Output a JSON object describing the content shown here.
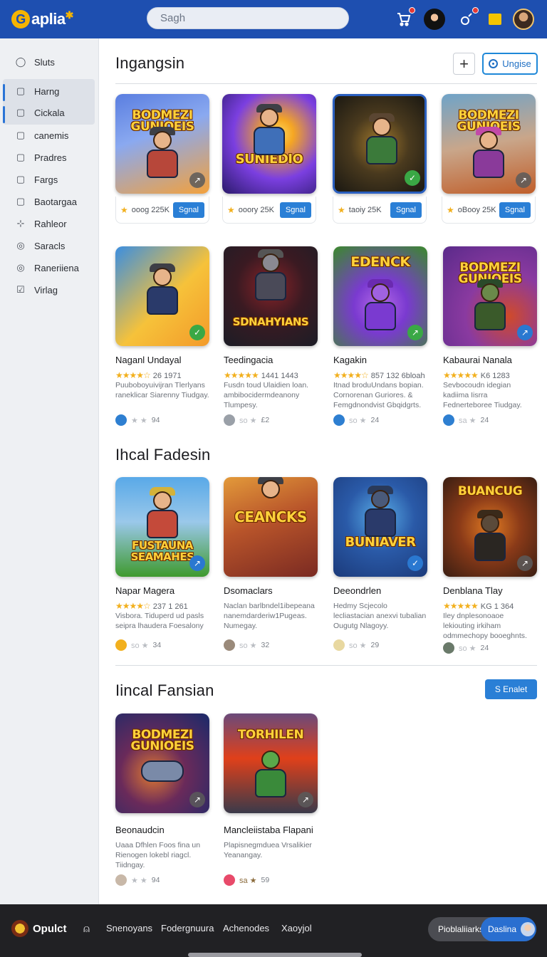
{
  "header": {
    "logo_text": "aplia",
    "search_placeholder": "Sagh",
    "icons": [
      "cart-icon",
      "user-avatar",
      "notification-icon",
      "yellow-square-icon",
      "profile-avatar"
    ]
  },
  "sidebar": {
    "items": [
      {
        "label": "Sluts",
        "icon": "chat-icon"
      },
      {
        "label": "Harng",
        "icon": "square-icon"
      },
      {
        "label": "Cickala",
        "icon": "square-icon"
      },
      {
        "label": "canemis",
        "icon": "square-icon"
      },
      {
        "label": "Pradres",
        "icon": "square-icon"
      },
      {
        "label": "Fargs",
        "icon": "square-icon"
      },
      {
        "label": "Baotargaa",
        "icon": "square-icon"
      },
      {
        "label": "Rahleor",
        "icon": "adjust-icon"
      },
      {
        "label": "Saracls",
        "icon": "target-icon"
      },
      {
        "label": "Raneriiena",
        "icon": "target-icon"
      },
      {
        "label": "Virlag",
        "icon": "check-square-icon"
      }
    ]
  },
  "sections": [
    {
      "title": "Ingangsin",
      "buttons": {
        "plus": "+",
        "outline": "Ungise"
      },
      "cards": [
        {
          "thumb_title": "BODMEZI GUNIOEIS",
          "price": "ooog 225K",
          "button": "Sgnal",
          "colors": [
            "#5a7ee0",
            "#f3a13c"
          ]
        },
        {
          "thumb_title": "SUNIEDIO",
          "price": "ooory 25K",
          "button": "Sgnal",
          "colors": [
            "#7b3fe0",
            "#f5a623"
          ]
        },
        {
          "thumb_title": "",
          "price": "taoiy 25K",
          "button": "Sgnal",
          "colors": [
            "#2f2a1e",
            "#a37a2c"
          ]
        },
        {
          "thumb_title": "BODMEZI GUNIOEIS",
          "price": "oBooy 25K",
          "button": "Sgnal",
          "colors": [
            "#6fa3c8",
            "#c05e2a"
          ]
        }
      ]
    },
    {
      "title": "",
      "cards": [
        {
          "thumb_title": "",
          "name": "Naganl Undayal",
          "rating": "26 1971",
          "desc": "Puuboboyuivijran Tlerlyans raneklicar Siarenny Tiudgay.",
          "meta": "94",
          "colors": [
            "#f6c23a",
            "#3b8ee0"
          ]
        },
        {
          "thumb_title": "SDNAHYIANS",
          "name": "Teedingacia",
          "rating": "1441 1443",
          "desc": "Fusdn toud Ulaidien loan. ambibocidermdeanony Tlumpesy.",
          "meta": "£2",
          "colors": [
            "#1c1d26",
            "#8a2328"
          ]
        },
        {
          "thumb_title": "EDENCK",
          "name": "Kagakin",
          "rating": "857 132 6bloah",
          "desc": "Itnad broduUndans bopian. Cornorenan Guriores. & Femgdnondvist Gbqidgrts.",
          "meta": "24",
          "colors": [
            "#3a8a2a",
            "#7a3ad0"
          ]
        },
        {
          "thumb_title": "BODMEZI GUNIOEIS",
          "name": "Kabaurai Nanala",
          "rating": "K6 1283",
          "desc": "Sevbocoudn idegian kadiima Iisrra Fednerteboree Tiudgay.",
          "meta": "24",
          "colors": [
            "#5a2a8a",
            "#d04a2a"
          ]
        }
      ]
    },
    {
      "title": "Ihcal Fadesin",
      "cards": [
        {
          "thumb_title": "FUSTAUNA SEAMAHES",
          "name": "Napar Magera",
          "rating": "237 1 261",
          "desc": "Visbora. Tiduperd ud pasls seipra lhaudera Foesalony",
          "meta": "34",
          "colors": [
            "#59a9e8",
            "#3f9a2e"
          ]
        },
        {
          "thumb_title": "CEANCKS",
          "name": "Dsomaclars",
          "rating": "",
          "desc": "Naclan barlbndel1ibepeana nanemdarderiw1Pugeas. Numegay.",
          "meta": "32",
          "colors": [
            "#7a2a22",
            "#e39a3a"
          ]
        },
        {
          "thumb_title": "BUNIAVER",
          "name": "Deeondrlen",
          "rating": "",
          "desc": "Hedmy Scjecolo lecliastacian anexvi tubalian Ougutg Nlagoyy.",
          "meta": "29",
          "colors": [
            "#1b3a7a",
            "#5aaee8"
          ]
        },
        {
          "thumb_title": "BUANCUG",
          "name": "Denblana Tlay",
          "rating": "KG 1 364",
          "desc": "Iley dnplesonoaoe lekiouting irkiham odmmechopy booeghnts.",
          "meta": "24",
          "colors": [
            "#3a1e12",
            "#e07a22"
          ]
        }
      ]
    },
    {
      "title": "Iincal Fansian",
      "button": "S Enalet",
      "cards": [
        {
          "thumb_title": "BODMEZI GUNIOEIS",
          "name": "Beonaudcin",
          "rating": "",
          "desc": "Uaaa Dfhlen Foos fina un Rienogen lokebl riagcl. Tiidngay.",
          "meta": "94",
          "colors": [
            "#1a2a6a",
            "#e07a30"
          ]
        },
        {
          "thumb_title": "TORHILEN",
          "name": "Mancleiistaba Flapani",
          "rating": "",
          "desc": "Plapisnegmduea Vrsalikier Yeanangay.",
          "meta": "59",
          "colors": [
            "#3a3a4a",
            "#e0401a"
          ]
        }
      ]
    }
  ],
  "footer": {
    "logo_text": "Opulct",
    "links": [
      "Snenoyans",
      "Fodergnuura",
      "Achenodes",
      "Xaoyjol"
    ],
    "pill_left": "Pioblaliiarks",
    "pill_right": "Daslina"
  }
}
